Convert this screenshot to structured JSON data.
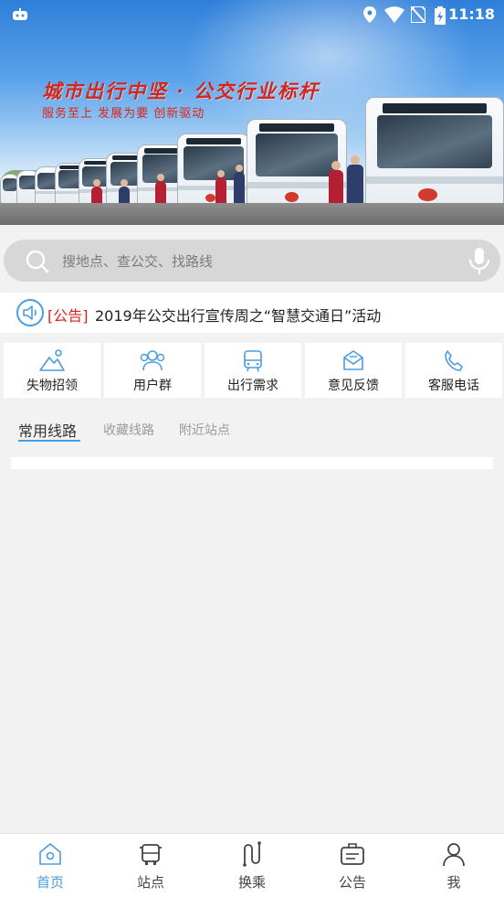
{
  "status_bar": {
    "time": "11:18"
  },
  "banner": {
    "slogan": "城市出行中坚 · 公交行业标杆",
    "sub_slogan": "服务至上 发展为要 创新驱动"
  },
  "search": {
    "placeholder": "搜地点、查公交、找路线"
  },
  "notice": {
    "tag": "[公告]",
    "text": "2019年公交出行宣传周之“智慧交通日”活动"
  },
  "quick_access": [
    {
      "label": "失物招领",
      "icon": "lost-found-icon"
    },
    {
      "label": "用户群",
      "icon": "user-group-icon"
    },
    {
      "label": "出行需求",
      "icon": "bus-icon"
    },
    {
      "label": "意见反馈",
      "icon": "mail-icon"
    },
    {
      "label": "客服电话",
      "icon": "phone-icon"
    }
  ],
  "tabs": [
    {
      "label": "常用线路",
      "active": true
    },
    {
      "label": "收藏线路",
      "active": false
    },
    {
      "label": "附近站点",
      "active": false
    }
  ],
  "bottom_nav": [
    {
      "label": "首页",
      "icon": "home-icon",
      "active": true
    },
    {
      "label": "站点",
      "icon": "bus-stop-icon",
      "active": false
    },
    {
      "label": "换乘",
      "icon": "transfer-icon",
      "active": false
    },
    {
      "label": "公告",
      "icon": "announcement-icon",
      "active": false
    },
    {
      "label": "我",
      "icon": "profile-icon",
      "active": false
    }
  ],
  "colors": {
    "accent": "#4a9de0",
    "notice_red": "#d8251a",
    "background": "#f2f2f2"
  }
}
